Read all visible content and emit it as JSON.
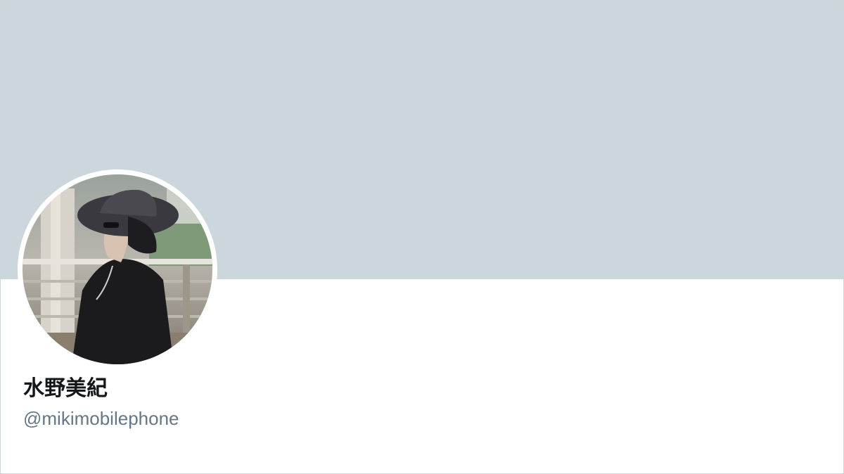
{
  "profile": {
    "display_name": "水野美紀",
    "handle": "@mikimobilephone",
    "avatar_icon": "profile-photo",
    "banner_color": "#ccd6dd",
    "name_color": "#14171a",
    "handle_color": "#657786"
  }
}
